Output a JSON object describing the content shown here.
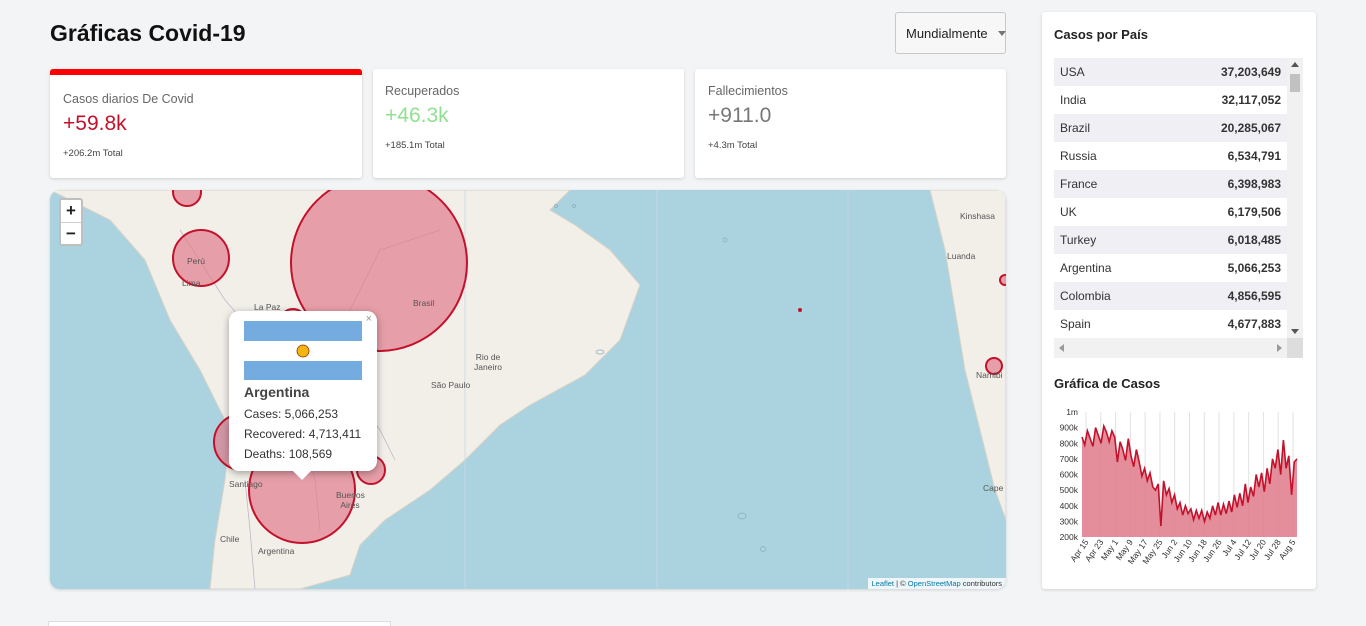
{
  "header": {
    "title": "Gráficas Covid-19",
    "region_select": "Mundialmente"
  },
  "cards": {
    "cases": {
      "label": "Casos diarios De Covid",
      "value": "+59.8k",
      "total": "+206.2m Total"
    },
    "recovered": {
      "label": "Recuperados",
      "value": "+46.3k",
      "total": "+185.1m Total"
    },
    "deaths": {
      "label": "Fallecimientos",
      "value": "+911.0",
      "total": "+4.3m Total"
    }
  },
  "map": {
    "zoom_in": "+",
    "zoom_out": "−",
    "labels": {
      "peru": "Perú",
      "lima": "Lima",
      "la_paz": "La Paz",
      "brasil": "Brasil",
      "rio": "Rio de Janeiro",
      "sao_paulo": "São Paulo",
      "santiago": "Santiago",
      "buenos_aires": "Buenos Aires",
      "chile": "Chile",
      "argentina": "Argentina",
      "kinshasa": "Kinshasa",
      "luanda": "Luanda",
      "namibia": "Namibi",
      "cape": "Cape"
    },
    "attribution": {
      "leaflet": "Leaflet",
      "sep": " | © ",
      "osm": "OpenStreetMap",
      "contrib": " contributors"
    },
    "popup": {
      "close": "×",
      "country": "Argentina",
      "cases": "Cases: 5,066,253",
      "recovered": "Recovered: 4,713,411",
      "deaths": "Deaths: 108,569"
    }
  },
  "sidebar": {
    "countries_title": "Casos por País",
    "countries": [
      {
        "name": "USA",
        "cases": "37,203,649"
      },
      {
        "name": "India",
        "cases": "32,117,052"
      },
      {
        "name": "Brazil",
        "cases": "20,285,067"
      },
      {
        "name": "Russia",
        "cases": "6,534,791"
      },
      {
        "name": "France",
        "cases": "6,398,983"
      },
      {
        "name": "UK",
        "cases": "6,179,506"
      },
      {
        "name": "Turkey",
        "cases": "6,018,485"
      },
      {
        "name": "Argentina",
        "cases": "5,066,253"
      },
      {
        "name": "Colombia",
        "cases": "4,856,595"
      },
      {
        "name": "Spain",
        "cases": "4,677,883"
      }
    ],
    "chart_title": "Gráfica de Casos"
  },
  "chart_data": {
    "type": "area",
    "title": "Gráfica de Casos",
    "color": "#c4112b",
    "fill": "#e07a8a",
    "ylim": [
      200000,
      1000000
    ],
    "y_ticks": [
      {
        "value": 1000000,
        "label": "1m"
      },
      {
        "value": 900000,
        "label": "900k"
      },
      {
        "value": 800000,
        "label": "800k"
      },
      {
        "value": 700000,
        "label": "700k"
      },
      {
        "value": 600000,
        "label": "600k"
      },
      {
        "value": 500000,
        "label": "500k"
      },
      {
        "value": 400000,
        "label": "400k"
      },
      {
        "value": 300000,
        "label": "300k"
      },
      {
        "value": 200000,
        "label": "200k"
      }
    ],
    "x_ticks": [
      "Apr 15",
      "Apr 23",
      "May 1",
      "May 9",
      "May 17",
      "May 25",
      "Jun 2",
      "Jun 10",
      "Jun 18",
      "Jun 26",
      "Jul 4",
      "Jul 12",
      "Jul 20",
      "Jul 28",
      "Aug 5"
    ],
    "values": [
      840000,
      790000,
      880000,
      830000,
      780000,
      900000,
      850000,
      800000,
      910000,
      870000,
      810000,
      880000,
      840000,
      680000,
      810000,
      760000,
      690000,
      830000,
      720000,
      650000,
      760000,
      680000,
      590000,
      640000,
      560000,
      610000,
      520000,
      500000,
      540000,
      270000,
      560000,
      470000,
      510000,
      420000,
      470000,
      380000,
      420000,
      340000,
      400000,
      350000,
      380000,
      310000,
      370000,
      320000,
      370000,
      300000,
      360000,
      320000,
      400000,
      340000,
      420000,
      340000,
      410000,
      350000,
      430000,
      360000,
      470000,
      390000,
      480000,
      400000,
      540000,
      420000,
      520000,
      460000,
      600000,
      520000,
      610000,
      490000,
      640000,
      540000,
      700000,
      640000,
      760000,
      600000,
      820000,
      640000,
      720000,
      470000,
      680000,
      700000
    ]
  }
}
